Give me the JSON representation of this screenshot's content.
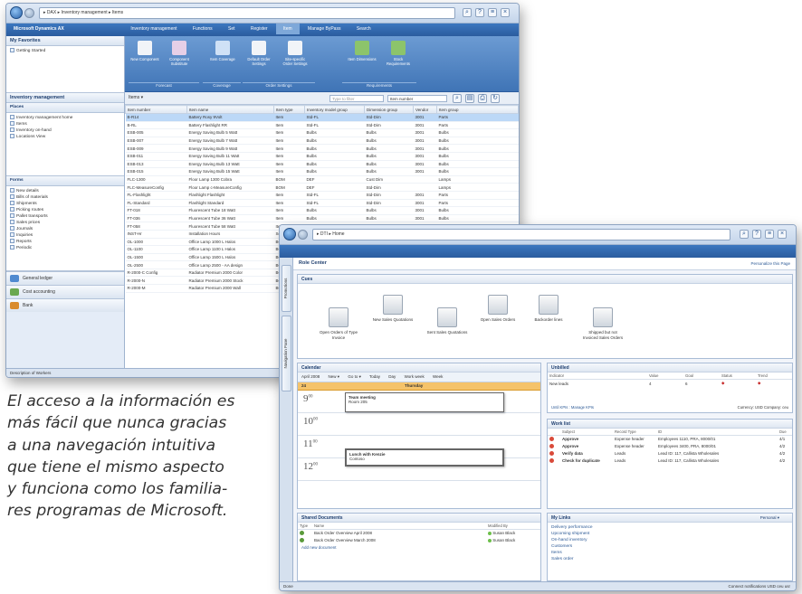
{
  "caption": {
    "lines": [
      "El acceso a la información es",
      "más fácil que nunca gracias",
      "a una navegación intuitiva",
      "que tiene el mismo aspecto",
      "y funciona como los familia-",
      "res programas de Microsoft."
    ]
  },
  "window1": {
    "breadcrumb": "▸ DAX ▸ Inventory management ▸ Items",
    "app_title": "Microsoft Dynamics AX",
    "subbar_tabs": [
      "Inventory management",
      "Functions",
      "Set",
      "Register",
      "Item",
      "Manage ByPass",
      "Search"
    ],
    "active_tab_index": 4,
    "favorites_title": "My Favorites",
    "favorites_items": [
      "Getting Started"
    ],
    "module_title": "Inventory management",
    "places_title": "Places",
    "places_items": [
      "Inventory management home",
      "Items",
      "Inventory on-hand",
      "Locations View"
    ],
    "forms_title": "Forms",
    "forms_items": [
      "New details",
      "Bills of materials",
      "Shipments",
      "Picking routes",
      "Pallet transports",
      "Sales prices",
      "Journals",
      "Inquiries",
      "Reports",
      "Periodic"
    ],
    "modules": [
      {
        "label": "General ledger",
        "color": "#4f8ad0"
      },
      {
        "label": "Cost accounting",
        "color": "#6aa84f"
      },
      {
        "label": "Bank",
        "color": "#d98a2b"
      }
    ],
    "status_text": "Description of Workers",
    "ribbon_buttons": [
      {
        "label": "New Component",
        "color": "#f1f4f8"
      },
      {
        "label": "Component Substitute",
        "color": "#e6cfe7"
      },
      {
        "label": "Item Coverage",
        "color": "#cfe1f6"
      },
      {
        "label": "Default Order Settings",
        "color": "#f1f4f8"
      },
      {
        "label": "Site-specific Order Settings",
        "color": "#f1f4f8"
      },
      {
        "label": "Item Dimensions",
        "color": "#8cc46b"
      },
      {
        "label": "Stock Requirements",
        "color": "#8cc46b"
      }
    ],
    "ribbon_groups": [
      "Forecast",
      "Coverage",
      "Order Settings",
      "Requirements"
    ],
    "filter_label": "Items ▾",
    "filter_placeholder": "Type to filter",
    "filter_field": "Item number",
    "columns": [
      "Item number",
      "Item name",
      "Item type",
      "Inventory model group",
      "Dimension group",
      "Vendor",
      "Item group"
    ],
    "rows": [
      [
        "B-R14",
        "Battery Rosy 9Volt",
        "Item",
        "Std-FL",
        "Std-Dim",
        "3001",
        "Parts"
      ],
      [
        "B-RL",
        "Battery Flashlight RR",
        "Item",
        "Std-FL",
        "Std-Dim",
        "3001",
        "Parts"
      ],
      [
        "ESB-005",
        "Energy Saving Bulb 5 Watt",
        "Item",
        "Bulbs",
        "Bulbs",
        "3001",
        "Bulbs"
      ],
      [
        "ESB-007",
        "Energy Saving Bulb 7 Watt",
        "Item",
        "Bulbs",
        "Bulbs",
        "3001",
        "Bulbs"
      ],
      [
        "ESB-009",
        "Energy Saving Bulb 9 Watt",
        "Item",
        "Bulbs",
        "Bulbs",
        "3001",
        "Bulbs"
      ],
      [
        "ESB-011",
        "Energy Saving Bulb 11 Watt",
        "Item",
        "Bulbs",
        "Bulbs",
        "3001",
        "Bulbs"
      ],
      [
        "ESB-013",
        "Energy Saving Bulb 13 Watt",
        "Item",
        "Bulbs",
        "Bulbs",
        "3001",
        "Bulbs"
      ],
      [
        "ESB-015",
        "Energy Saving Bulb 15 Watt",
        "Item",
        "Bulbs",
        "Bulbs",
        "3001",
        "Bulbs"
      ],
      [
        "FLC-1300",
        "Floor Lamp 1300 Cobra",
        "BOM",
        "DEF",
        "Cust Dim",
        "",
        "Lamps"
      ],
      [
        "FLC-MeasureConfig",
        "Floor Lamp c-MeasureConfig",
        "BOM",
        "DEF",
        "Std-Dim",
        "",
        "Lamps"
      ],
      [
        "FL-Flashlight",
        "Flashlight Flashlight",
        "Item",
        "Std-FL",
        "Std-Dim",
        "3001",
        "Parts"
      ],
      [
        "FL-Standard",
        "Flashlight Standard",
        "Item",
        "Std-FL",
        "Std-Dim",
        "3001",
        "Parts"
      ],
      [
        "FT-018",
        "Fluorescent Tube 18 Watt",
        "Item",
        "Bulbs",
        "Bulbs",
        "3001",
        "Bulbs"
      ],
      [
        "FT-036",
        "Fluorescent Tube 36 Watt",
        "Item",
        "Bulbs",
        "Bulbs",
        "3001",
        "Bulbs"
      ],
      [
        "FT-058",
        "Fluorescent Tube 58 Watt",
        "Item",
        "Bulbs",
        "Bulbs",
        "3001",
        "Bulbs"
      ],
      [
        "INST-Hr",
        "Installation Hours",
        "Service",
        "Service",
        "Std-Dim",
        "",
        "Service"
      ],
      [
        "OL-1000",
        "Office Lamp 1000 L Halos",
        "BOM",
        "DEF",
        "Std-Dim",
        "",
        "Lamps"
      ],
      [
        "OL-1100",
        "Office Lamp 1100 L Halos",
        "BOM",
        "DEF",
        "Std-Dim",
        "",
        "Lamps"
      ],
      [
        "OL-1500",
        "Office Lamp 1500 L Halos",
        "BOM",
        "DEF",
        "Std-Dim",
        "",
        "Lamps"
      ],
      [
        "OL-2500",
        "Office Lamp 2500 - AA design",
        "BOM",
        "DEF",
        "Std-Dim",
        "",
        "Lamps"
      ],
      [
        "R-2000-C Config",
        "Radiator Premium 2000 Color",
        "BOM",
        "DEF",
        "Cust Dim",
        "",
        "Lamps"
      ],
      [
        "R-2000-N",
        "Radiator Premium 2000 Stock",
        "BOM",
        "DEF",
        "Std-Dim",
        "",
        "Lamps"
      ],
      [
        "R-2000-M",
        "Radiator Premium 2000 Wall",
        "BOM",
        "DEF",
        "Std-Dim",
        "",
        "Lamps"
      ]
    ],
    "selected_row_index": 0
  },
  "window2": {
    "breadcrumb": "▸ DTI ▸ Home",
    "vertical_tabs": [
      "Promotions",
      "Navigation Pane"
    ],
    "page_title": "Role Center",
    "personalize_link": "Personalize this Page",
    "cues_title": "Cues",
    "flow_items": [
      "Open Orders of Type Invoice",
      "New Sales Quotations",
      "Sent Sales Quotations",
      "Open Sales Orders",
      "Backorder lines",
      "Shipped but not Invoiced Sales Orders"
    ],
    "calendar": {
      "title": "Calendar",
      "toolbar": [
        "April 2008",
        "New ▾",
        "Go to ▾",
        "Today",
        "Day",
        "Work week",
        "Week"
      ],
      "day_number": "24",
      "day_name": "Thursday",
      "hours": [
        {
          "hour": "9",
          "min": "00"
        },
        {
          "hour": "10",
          "min": "00"
        },
        {
          "hour": "11",
          "min": "00"
        },
        {
          "hour": "12",
          "min": "00"
        }
      ],
      "appointments": [
        {
          "title": "Team meeting",
          "location": "Room 205"
        },
        {
          "title": "Lunch with Kenzie",
          "location": "Contoso"
        }
      ]
    },
    "kpi": {
      "title": "Unbilled",
      "columns": [
        "Indicator",
        "Value",
        "Goal",
        "Status",
        "Trend"
      ],
      "rows": [
        [
          "New leads",
          "4",
          "6",
          "◆",
          "◆"
        ]
      ],
      "footer_left": "Until KPIs : Manage KPIs",
      "footer_right": "Currency: USD  Company: ceu"
    },
    "worklist": {
      "title": "Work list",
      "columns": [
        "",
        "Subject",
        "Record Type",
        "ID",
        "Due"
      ],
      "rows": [
        [
          "Approve",
          "Expense header",
          "Employees 1110, PRA, 8000/01",
          "4/1"
        ],
        [
          "Approve",
          "Expense header",
          "Employees 3400, PRA, 8000/01",
          "4/2"
        ],
        [
          "Verify data",
          "Leads",
          "Lead ID: 117, Callista Wholesales",
          "4/2"
        ],
        [
          "Check for duplicate",
          "Leads",
          "Lead ID: 117, Callista Wholesales",
          "4/2"
        ]
      ]
    },
    "documents": {
      "title": "Shared Documents",
      "columns": [
        "Type",
        "Name",
        "Modified By"
      ],
      "rows": [
        [
          "Back Order Overview April 2008",
          "Susan Black"
        ],
        [
          "Back Order Overview March 2008",
          "Susan Black"
        ]
      ],
      "add_link": "Add new document"
    },
    "links": {
      "title": "My Links",
      "dropdown": "Personal ▾",
      "items": [
        "Delivery performance",
        "Upcoming shipment",
        "On-hand inventory",
        "Customers",
        "Items",
        "Sales order"
      ]
    },
    "status_text": "Done",
    "status_right": "Connect notifications  USD  ceu  usr"
  }
}
